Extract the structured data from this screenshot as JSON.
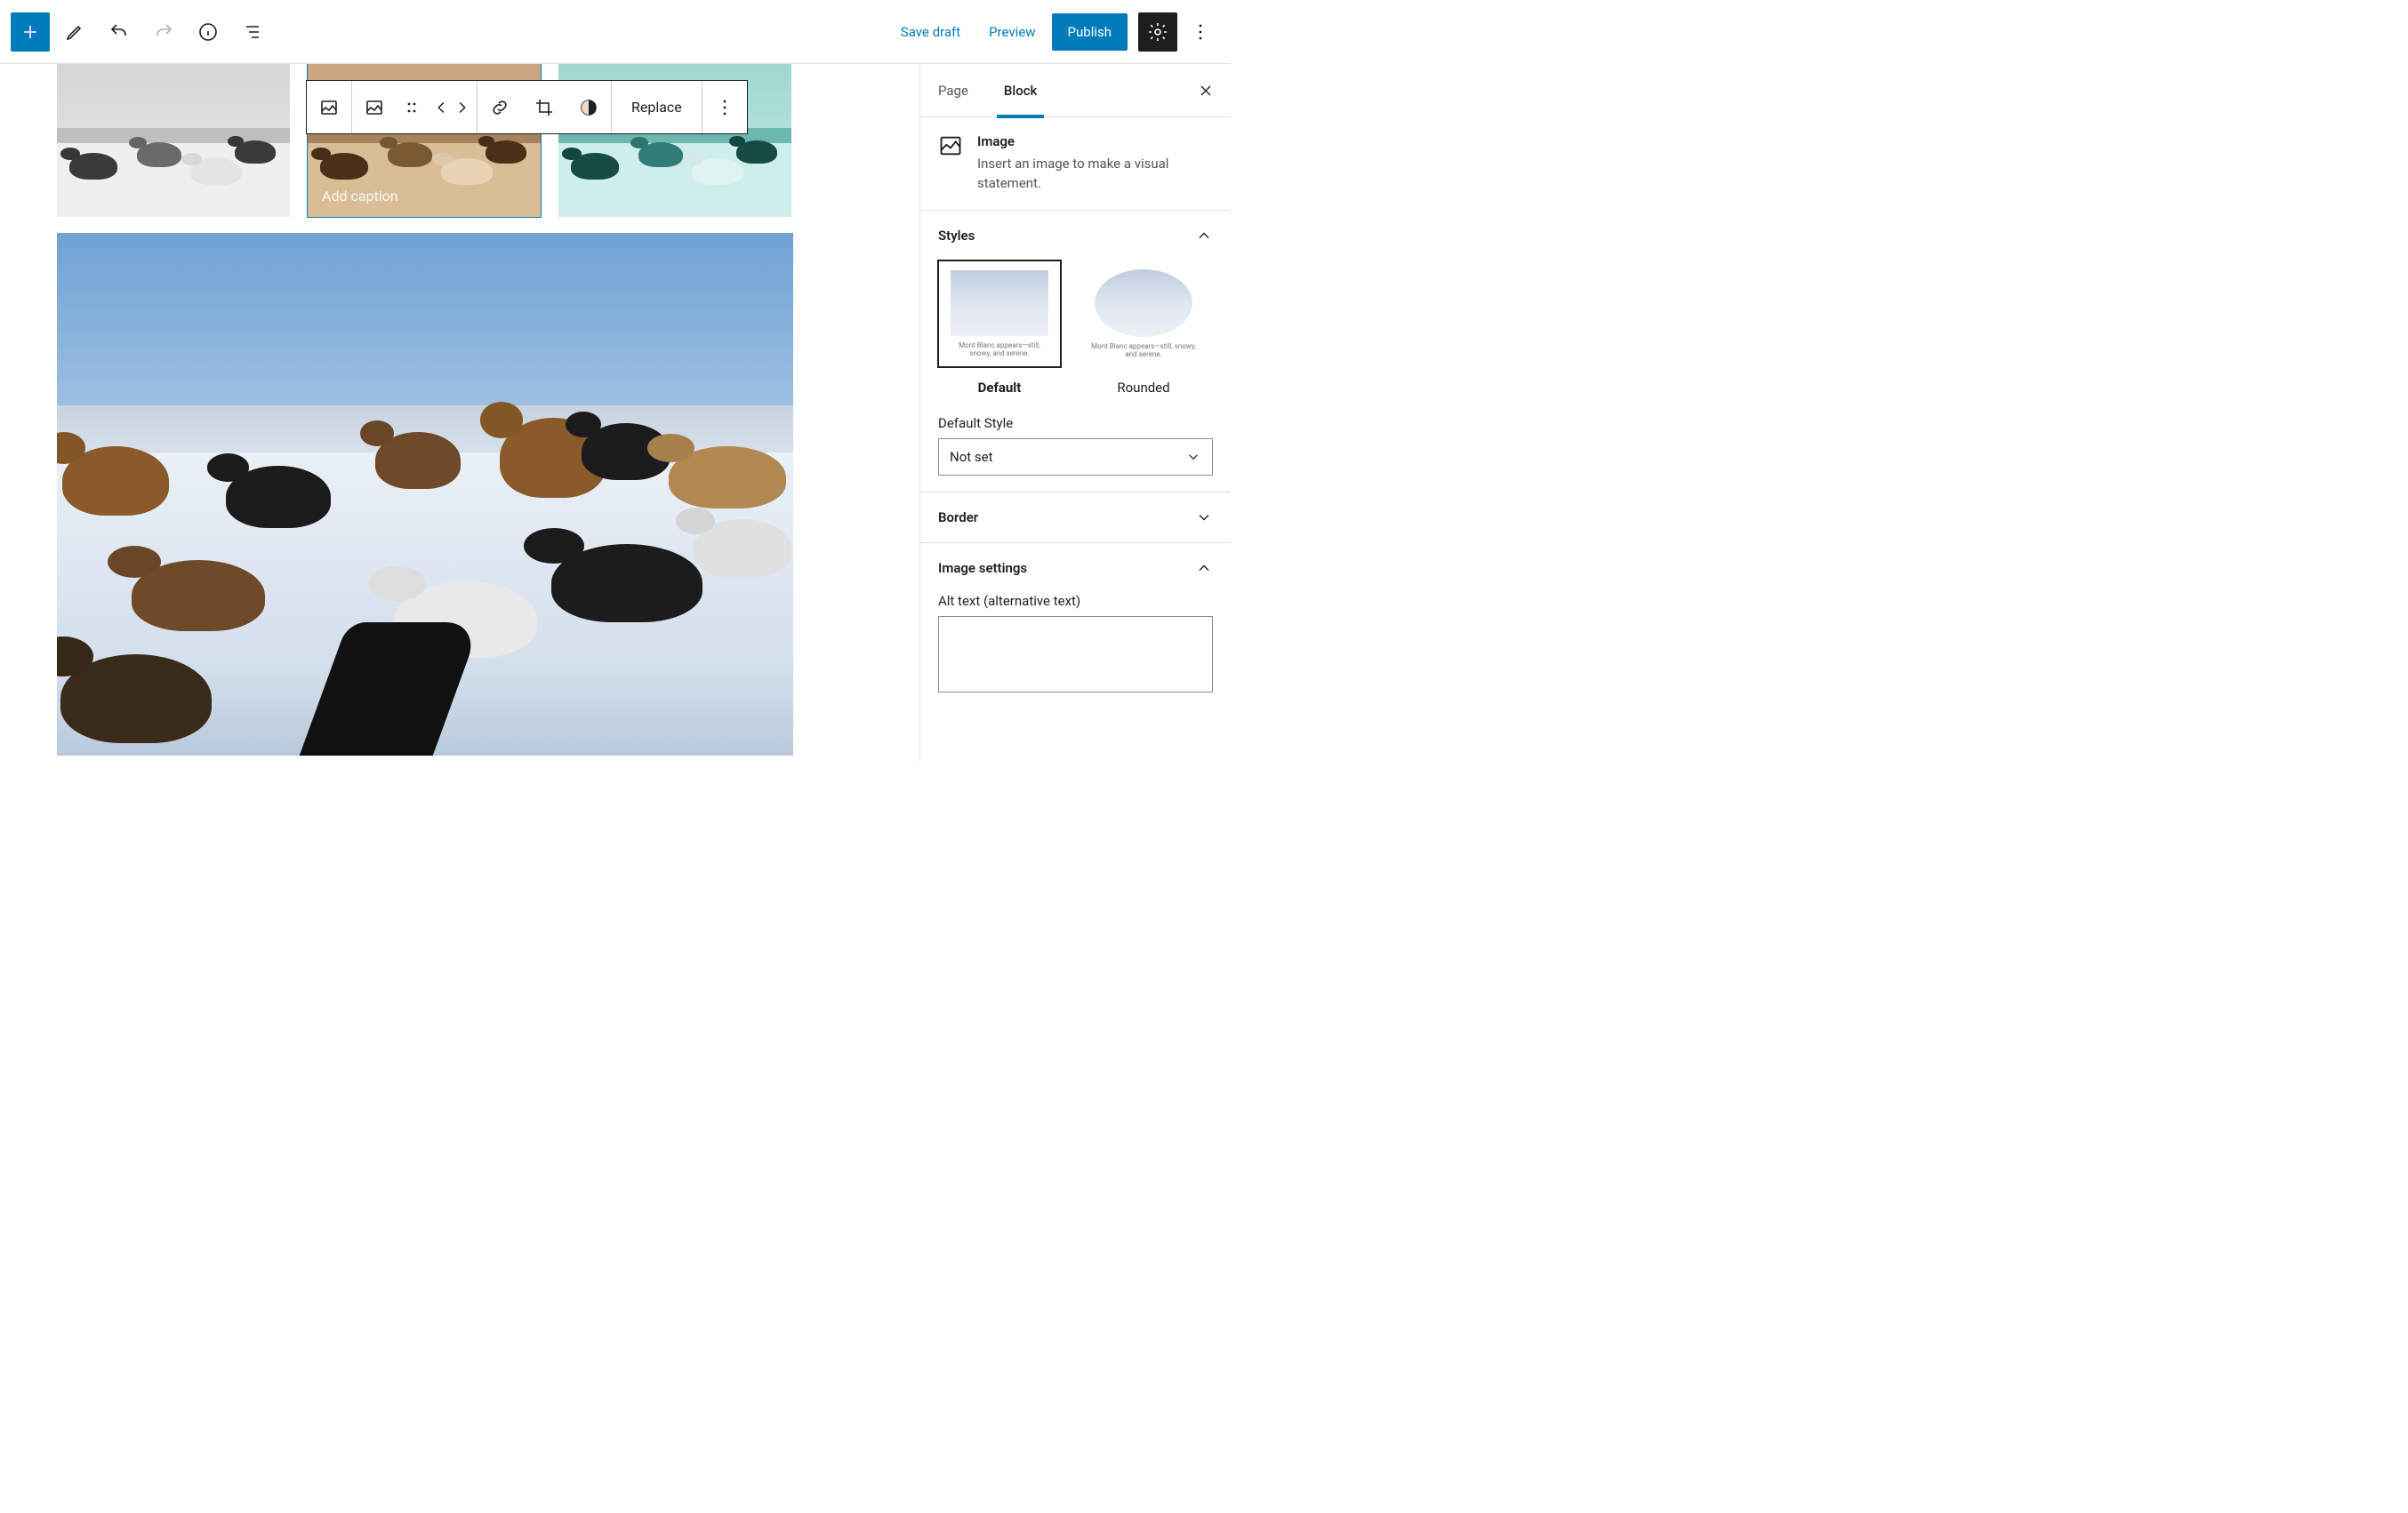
{
  "topbar": {
    "save_draft": "Save draft",
    "preview": "Preview",
    "publish": "Publish"
  },
  "block_toolbar": {
    "replace": "Replace"
  },
  "caption_placeholder": "Add caption",
  "sidebar": {
    "tabs": {
      "page": "Page",
      "block": "Block"
    },
    "block_name": "Image",
    "block_desc": "Insert an image to make a visual statement.",
    "panels": {
      "styles": "Styles",
      "border": "Border",
      "image_settings": "Image settings"
    },
    "styles": {
      "default": "Default",
      "rounded": "Rounded",
      "preview_caption": "Mont Blanc appears—still, snowy, and serene.",
      "default_style_label": "Default Style",
      "default_style_value": "Not set"
    },
    "alt_label": "Alt text (alternative text)",
    "alt_value": ""
  },
  "thumb_filters": {
    "a": {
      "sky": "#d6d6d6",
      "mtn": "#bfbfbf",
      "snow": "#efefef",
      "dog1": "#3a3a3a",
      "dog2": "#6a6a6a",
      "dog3": "#e4e4e4"
    },
    "b": {
      "sky": "#c7a67f",
      "mtn": "#a5835c",
      "snow": "#d9bd97",
      "dog1": "#4a3018",
      "dog2": "#7a5a33",
      "dog3": "#e8d3b5"
    },
    "c": {
      "sky": "#9fd7d1",
      "mtn": "#6cb7b0",
      "snow": "#cdeeea",
      "dog1": "#154a45",
      "dog2": "#2f7d76",
      "dog3": "#dff4f1"
    }
  },
  "big": {
    "sky1": "#8fb6dd",
    "sky2": "#bdd6ee",
    "mtn": "#cfd9e3",
    "snow1": "#e6edf4",
    "snow2": "#c9d7e5",
    "dog_brown": "#8a5a2a",
    "dog_black": "#1c1c1c",
    "dog_white": "#e9e9e9",
    "dog_mix": "#6f4a2a"
  }
}
